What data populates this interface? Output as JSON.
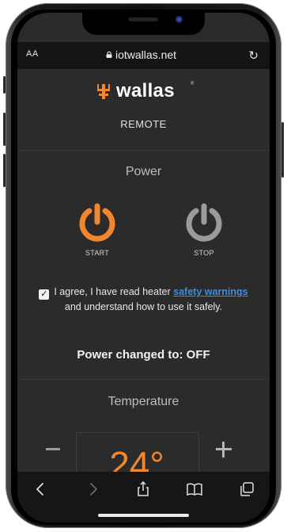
{
  "browser": {
    "text_size_label": "AA",
    "url": "iotwallas.net"
  },
  "brand": {
    "name": "wallas",
    "registered": "®",
    "subtitle": "REMOTE",
    "accent_color": "#f0862d"
  },
  "power": {
    "title": "Power",
    "start_label": "START",
    "stop_label": "STOP",
    "consent": {
      "prefix": "I agree, I have read heater",
      "link": "safety warnings",
      "suffix": "and understand how to use it safely.",
      "checked": true
    },
    "status": "Power changed to: OFF"
  },
  "temperature": {
    "title": "Temperature",
    "value": "24°",
    "decrease": "−",
    "increase": "+"
  },
  "toolbar": {
    "icons": [
      "back-icon",
      "forward-icon",
      "share-icon",
      "bookmarks-icon",
      "tabs-icon"
    ]
  }
}
